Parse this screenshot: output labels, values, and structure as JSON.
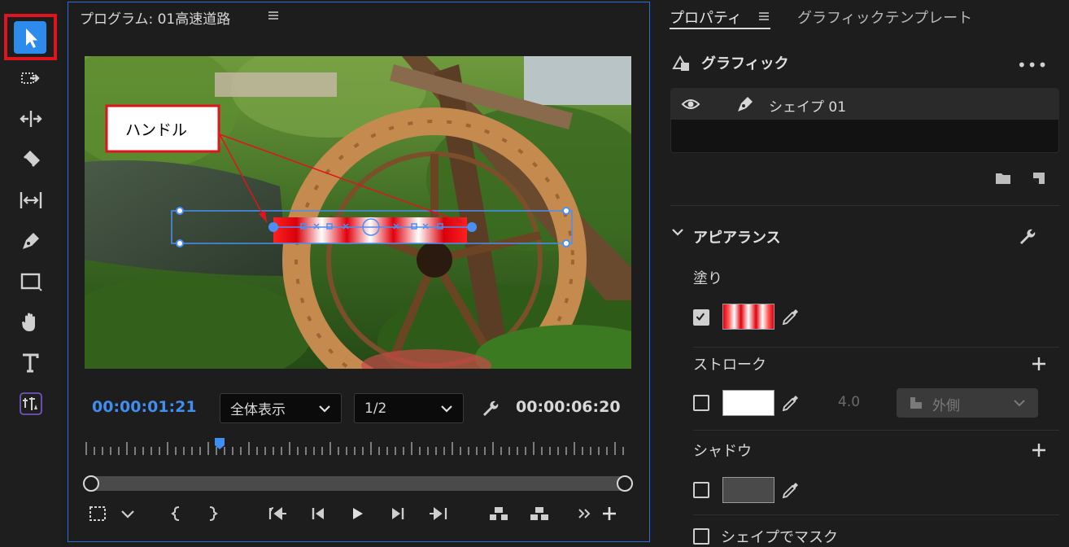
{
  "toolbar": {
    "tools": [
      "selection-tool",
      "track-select-forward-tool",
      "ripple-edit-tool",
      "razor-tool",
      "slip-tool",
      "pen-tool",
      "rectangle-tool",
      "hand-tool",
      "type-tool",
      "vertical-type-tool"
    ]
  },
  "program_monitor": {
    "title": "プログラム: 01高速道路",
    "callout_label": "ハンドル",
    "timecode_current": "00:00:01:21",
    "zoom": "全体表示",
    "quality": "1/2",
    "timecode_duration": "00:00:06:20"
  },
  "properties": {
    "tab_properties": "プロパティ",
    "tab_graphic_templates": "グラフィックテンプレート",
    "graphic_label": "グラフィック",
    "more_label": "•••",
    "layer_name": "シェイプ 01",
    "appearance_label": "アピアランス",
    "fill_label": "塗り",
    "fill_checked": true,
    "stroke_label": "ストローク",
    "stroke_checked": false,
    "stroke_width": "4.0",
    "stroke_position": "外側",
    "shadow_label": "シャドウ",
    "shadow_checked": false,
    "mask_label": "シェイプでマスク",
    "mask_checked": false
  },
  "colors": {
    "accent_blue": "#2d8ceb",
    "timecode_blue": "#3f8ef0",
    "highlight_red": "#e0141c",
    "panel_border": "#2b6fd6"
  }
}
